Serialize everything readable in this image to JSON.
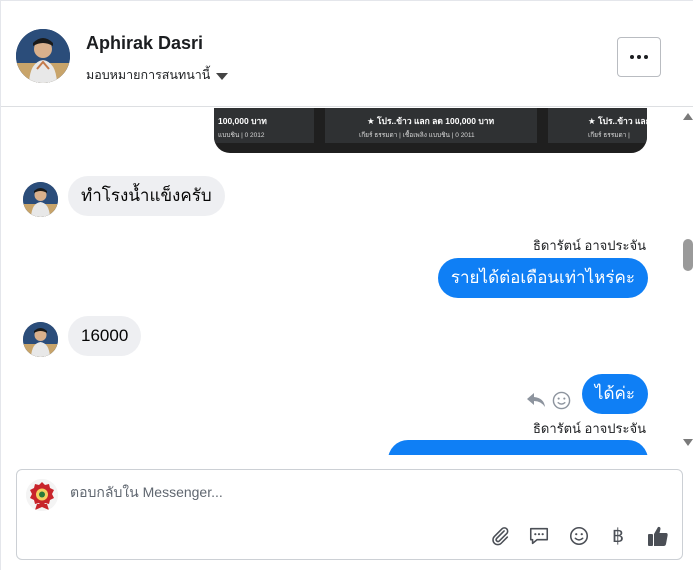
{
  "header": {
    "contact_name": "Aphirak Dasri",
    "assign_label": "มอบหมายการสนทนานี้",
    "more_icon": "more-horizontal-icon"
  },
  "product_cards": [
    {
      "title": "100,000 บาท",
      "meta": "แบบชิน | 0 2012"
    },
    {
      "title": "★ โปร..ข้าว แลก ลด 100,000 บาท",
      "meta": "เกียร์ ธรรมดา | เชื้อเพลิง แบบชิน | 0 2011"
    },
    {
      "title": "★ โปร..ข้าว แลก",
      "meta": "เกียร์ ธรรมดา | "
    }
  ],
  "messages": [
    {
      "direction": "in",
      "text": "ทำโรงน้ำแข็งครับ"
    },
    {
      "direction": "out",
      "sender": "ธิดารัตน์ อาจประจัน",
      "text": "รายได้ต่อเดือนเท่าไหร่คะ"
    },
    {
      "direction": "in",
      "text": "16000"
    },
    {
      "direction": "out",
      "text": "ได้ค่ะ"
    },
    {
      "direction": "out",
      "sender": "ธิดารัตน์ อาจประจัน",
      "text": ""
    }
  ],
  "message_actions": {
    "reply_icon": "reply-icon",
    "react_icon": "smile-icon"
  },
  "composer": {
    "placeholder": "ตอบกลับใน Messenger...",
    "tools": [
      "paperclip-icon",
      "chat-bubble-icon",
      "smile-icon",
      "baht-icon",
      "thumbs-up-icon"
    ],
    "baht_symbol": "฿"
  },
  "colors": {
    "outgoing_bubble": "#0f7ff5",
    "incoming_bubble": "#eeeff2",
    "card_background": "#2f3133"
  }
}
